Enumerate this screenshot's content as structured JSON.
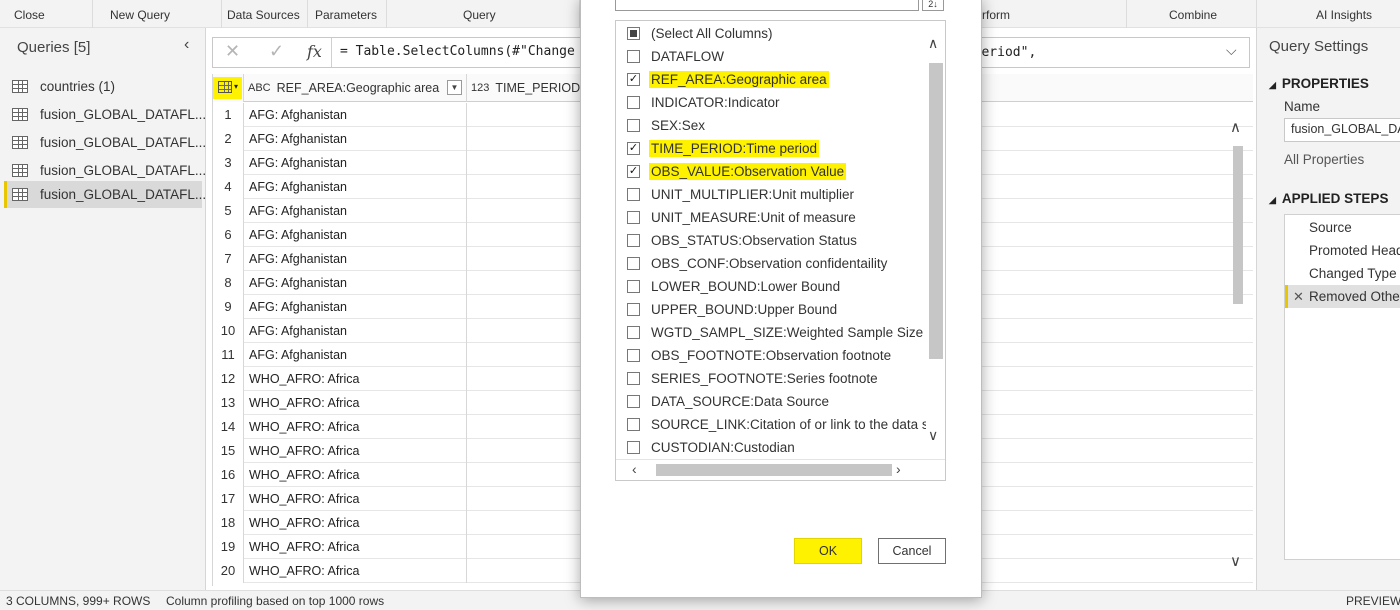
{
  "ribbon": {
    "groups": [
      "Close",
      "New Query",
      "Data Sources",
      "Parameters",
      "Query",
      "rform",
      "Combine",
      "AI Insights"
    ]
  },
  "queries": {
    "title": "Queries [5]",
    "items": [
      "countries (1)",
      "fusion_GLOBAL_DATAFL...",
      "fusion_GLOBAL_DATAFL...",
      "fusion_GLOBAL_DATAFL...",
      "fusion_GLOBAL_DATAFL..."
    ],
    "selected_index": 4
  },
  "formula": {
    "fx": "fx",
    "text": "= Table.SelectColumns(#\"Change",
    "text_tail": "e period\","
  },
  "grid": {
    "col1_type": "ABC",
    "col1_header": "REF_AREA:Geographic area",
    "col2_type": "123",
    "col2_header": "TIME_PERIOD:T",
    "rows": [
      {
        "n": "1",
        "v": "AFG: Afghanistan"
      },
      {
        "n": "2",
        "v": "AFG: Afghanistan"
      },
      {
        "n": "3",
        "v": "AFG: Afghanistan"
      },
      {
        "n": "4",
        "v": "AFG: Afghanistan"
      },
      {
        "n": "5",
        "v": "AFG: Afghanistan"
      },
      {
        "n": "6",
        "v": "AFG: Afghanistan"
      },
      {
        "n": "7",
        "v": "AFG: Afghanistan"
      },
      {
        "n": "8",
        "v": "AFG: Afghanistan"
      },
      {
        "n": "9",
        "v": "AFG: Afghanistan"
      },
      {
        "n": "10",
        "v": "AFG: Afghanistan"
      },
      {
        "n": "11",
        "v": "AFG: Afghanistan"
      },
      {
        "n": "12",
        "v": "WHO_AFRO: Africa"
      },
      {
        "n": "13",
        "v": "WHO_AFRO: Africa"
      },
      {
        "n": "14",
        "v": "WHO_AFRO: Africa"
      },
      {
        "n": "15",
        "v": "WHO_AFRO: Africa"
      },
      {
        "n": "16",
        "v": "WHO_AFRO: Africa"
      },
      {
        "n": "17",
        "v": "WHO_AFRO: Africa"
      },
      {
        "n": "18",
        "v": "WHO_AFRO: Africa"
      },
      {
        "n": "19",
        "v": "WHO_AFRO: Africa"
      },
      {
        "n": "20",
        "v": "WHO_AFRO: Africa"
      }
    ]
  },
  "dialog": {
    "search_value": "",
    "sort_icon": "sort-icon",
    "columns": [
      {
        "label": "(Select All Columns)",
        "state": "partial",
        "highlight": false
      },
      {
        "label": "DATAFLOW",
        "state": "unchecked",
        "highlight": false
      },
      {
        "label": "REF_AREA:Geographic area",
        "state": "checked",
        "highlight": true
      },
      {
        "label": "INDICATOR:Indicator",
        "state": "unchecked",
        "highlight": false
      },
      {
        "label": "SEX:Sex",
        "state": "unchecked",
        "highlight": false
      },
      {
        "label": "TIME_PERIOD:Time period",
        "state": "checked",
        "highlight": true
      },
      {
        "label": "OBS_VALUE:Observation Value",
        "state": "checked",
        "highlight": true
      },
      {
        "label": "UNIT_MULTIPLIER:Unit multiplier",
        "state": "unchecked",
        "highlight": false
      },
      {
        "label": "UNIT_MEASURE:Unit of measure",
        "state": "unchecked",
        "highlight": false
      },
      {
        "label": "OBS_STATUS:Observation Status",
        "state": "unchecked",
        "highlight": false
      },
      {
        "label": "OBS_CONF:Observation confidentaility",
        "state": "unchecked",
        "highlight": false
      },
      {
        "label": "LOWER_BOUND:Lower Bound",
        "state": "unchecked",
        "highlight": false
      },
      {
        "label": "UPPER_BOUND:Upper Bound",
        "state": "unchecked",
        "highlight": false
      },
      {
        "label": "WGTD_SAMPL_SIZE:Weighted Sample Size",
        "state": "unchecked",
        "highlight": false
      },
      {
        "label": "OBS_FOOTNOTE:Observation footnote",
        "state": "unchecked",
        "highlight": false
      },
      {
        "label": "SERIES_FOOTNOTE:Series footnote",
        "state": "unchecked",
        "highlight": false
      },
      {
        "label": "DATA_SOURCE:Data Source",
        "state": "unchecked",
        "highlight": false
      },
      {
        "label": "SOURCE_LINK:Citation of or link to the data sc",
        "state": "unchecked",
        "highlight": false
      },
      {
        "label": "CUSTODIAN:Custodian",
        "state": "unchecked",
        "highlight": false
      }
    ],
    "ok_label": "OK",
    "cancel_label": "Cancel"
  },
  "settings": {
    "title": "Query Settings",
    "properties_label": "PROPERTIES",
    "name_label": "Name",
    "name_value": "fusion_GLOBAL_DA",
    "all_properties": "All Properties",
    "applied_steps_label": "APPLIED STEPS",
    "steps": [
      "Source",
      "Promoted Head",
      "Changed Type",
      "Removed Othe"
    ],
    "selected_step": 3
  },
  "status": {
    "columns_rows": "3 COLUMNS, 999+ ROWS",
    "profiling": "Column profiling based on top 1000 rows",
    "preview": "PREVIEW"
  },
  "colors": {
    "highlight": "#fff200",
    "accent": "#e8c600",
    "pane_bg": "#f3f3f3"
  }
}
